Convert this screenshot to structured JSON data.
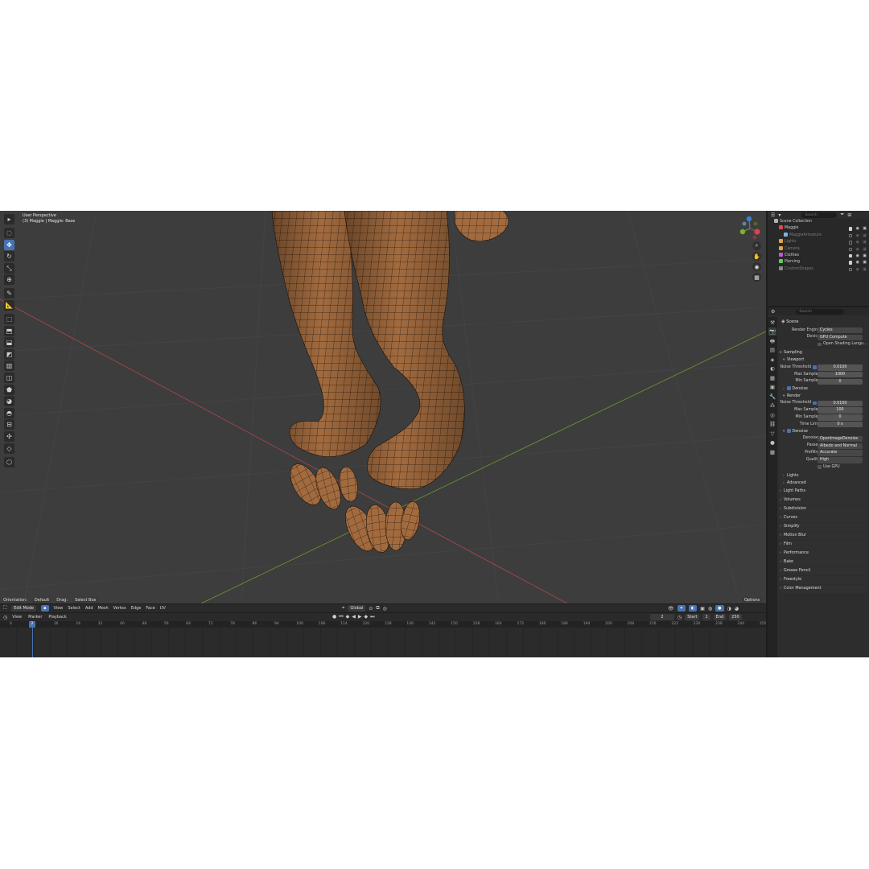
{
  "viewport": {
    "title": "User Perspective",
    "subtitle": "(3) Maggie | Maggie: Base"
  },
  "tools": [
    {
      "icon": "cursor-icon",
      "glyph": "▸"
    },
    {
      "icon": "select-circle-icon",
      "glyph": "◌"
    },
    {
      "icon": "move-icon",
      "glyph": "✥"
    },
    {
      "icon": "rotate-icon",
      "glyph": "↻"
    },
    {
      "icon": "scale-icon",
      "glyph": "⤡"
    },
    {
      "icon": "transform-icon",
      "glyph": "⊕"
    },
    {
      "icon": "annotate-icon",
      "glyph": "✎"
    },
    {
      "icon": "measure-icon",
      "glyph": "📐"
    },
    {
      "icon": "add-cube-icon",
      "glyph": "⬚"
    },
    {
      "icon": "extrude-icon",
      "glyph": "⬒"
    },
    {
      "icon": "inset-icon",
      "glyph": "⬓"
    },
    {
      "icon": "bevel-icon",
      "glyph": "◩"
    },
    {
      "icon": "loop-cut-icon",
      "glyph": "▥"
    },
    {
      "icon": "knife-icon",
      "glyph": "◫"
    },
    {
      "icon": "poly-build-icon",
      "glyph": "⬟"
    },
    {
      "icon": "spin-icon",
      "glyph": "◕"
    },
    {
      "icon": "smooth-icon",
      "glyph": "◓"
    },
    {
      "icon": "edge-slide-icon",
      "glyph": "⊟"
    },
    {
      "icon": "shrink-fatten-icon",
      "glyph": "✣"
    },
    {
      "icon": "shear-icon",
      "glyph": "◇"
    },
    {
      "icon": "rip-region-icon",
      "glyph": "⬡"
    }
  ],
  "tool_settings_bar": {
    "orientation_label": "Orientation:",
    "orientation_value": "Default",
    "drag_label": "Drag:",
    "drag_value": "Select Box",
    "options": "Options"
  },
  "header_bar": {
    "mode": "Edit Mode",
    "menus": [
      "View",
      "Select",
      "Add",
      "Mesh",
      "Vertex",
      "Edge",
      "Face",
      "UV"
    ],
    "transform_orientation": "Global"
  },
  "timeline": {
    "menus": [
      "View",
      "Marker",
      "Playback"
    ],
    "current_frame": "2",
    "start_label": "Start",
    "start_value": "1",
    "end_label": "End",
    "end_value": "250",
    "ticks": [
      "0",
      "2",
      "8",
      "16",
      "24",
      "32",
      "40",
      "48",
      "56",
      "64",
      "72",
      "78",
      "86",
      "94",
      "100",
      "106",
      "114",
      "120",
      "128",
      "136",
      "142",
      "150",
      "158",
      "164",
      "172",
      "180",
      "186",
      "194",
      "200",
      "208",
      "216",
      "222",
      "230",
      "238",
      "244",
      "250"
    ]
  },
  "outliner": {
    "search_placeholder": "Search",
    "rows": [
      {
        "label": "Scene Collection",
        "icon_color": "#b0b0b0",
        "dim": false,
        "indent": 0,
        "checks": false
      },
      {
        "label": "Maggie",
        "icon_color": "#e04a4a",
        "dim": false,
        "indent": 1,
        "checks": true
      },
      {
        "label": "MaggieArmature",
        "icon_color": "#7fb3e0",
        "dim": true,
        "indent": 2,
        "checks": true
      },
      {
        "label": "Lights",
        "icon_color": "#e0a54a",
        "dim": true,
        "indent": 1,
        "checks": true
      },
      {
        "label": "Camera",
        "icon_color": "#e0a54a",
        "dim": true,
        "indent": 1,
        "checks": true
      },
      {
        "label": "Clothes",
        "icon_color": "#c05ad0",
        "dim": false,
        "indent": 1,
        "checks": true
      },
      {
        "label": "Piercing",
        "icon_color": "#5ad05a",
        "dim": false,
        "indent": 1,
        "checks": true
      },
      {
        "label": "CustomShapes",
        "icon_color": "#8a8a8a",
        "dim": true,
        "indent": 1,
        "checks": true
      }
    ]
  },
  "properties": {
    "search_placeholder": "Search",
    "scene_title": "Scene",
    "render_engine_label": "Render Engine",
    "render_engine_value": "Cycles",
    "device_label": "Device",
    "device_value": "GPU Compute",
    "osl_label": "Open Shading Langu...",
    "sampling": {
      "title": "Sampling",
      "viewport_title": "Viewport",
      "vp_noise_label": "Noise Threshold",
      "vp_noise_value": "0.0100",
      "vp_max_label": "Max Samples",
      "vp_max_value": "1000",
      "vp_min_label": "Min Samples",
      "vp_min_value": "0",
      "vp_denoise_label": "Denoise",
      "render_title": "Render",
      "r_noise_label": "Noise Threshold",
      "r_noise_value": "0.0100",
      "r_max_label": "Max Samples",
      "r_max_value": "100",
      "r_min_label": "Min Samples",
      "r_min_value": "0",
      "r_time_label": "Time Limit",
      "r_time_value": "0 s",
      "r_denoise_label": "Denoise",
      "denoiser_label": "Denoiser",
      "denoiser_value": "OpenImageDenoise",
      "passes_label": "Passes",
      "passes_value": "Albedo and Normal",
      "prefilter_label": "Prefilter",
      "prefilter_value": "Accurate",
      "quality_label": "Quality",
      "quality_value": "High",
      "use_gpu_label": "Use GPU",
      "lights_label": "Lights",
      "advanced_label": "Advanced"
    },
    "panels": [
      "Light Paths",
      "Volumes",
      "Subdivision",
      "Curves",
      "Simplify",
      "Motion Blur",
      "Film",
      "Performance",
      "Bake",
      "Grease Pencil",
      "Freestyle",
      "Color Management"
    ]
  },
  "colors": {
    "accent": "#4772b3",
    "viewport_bg": "#3d3d3d",
    "mesh": "#a26b3f",
    "x_axis": "#b0464b",
    "y_axis": "#6c9a2e"
  }
}
